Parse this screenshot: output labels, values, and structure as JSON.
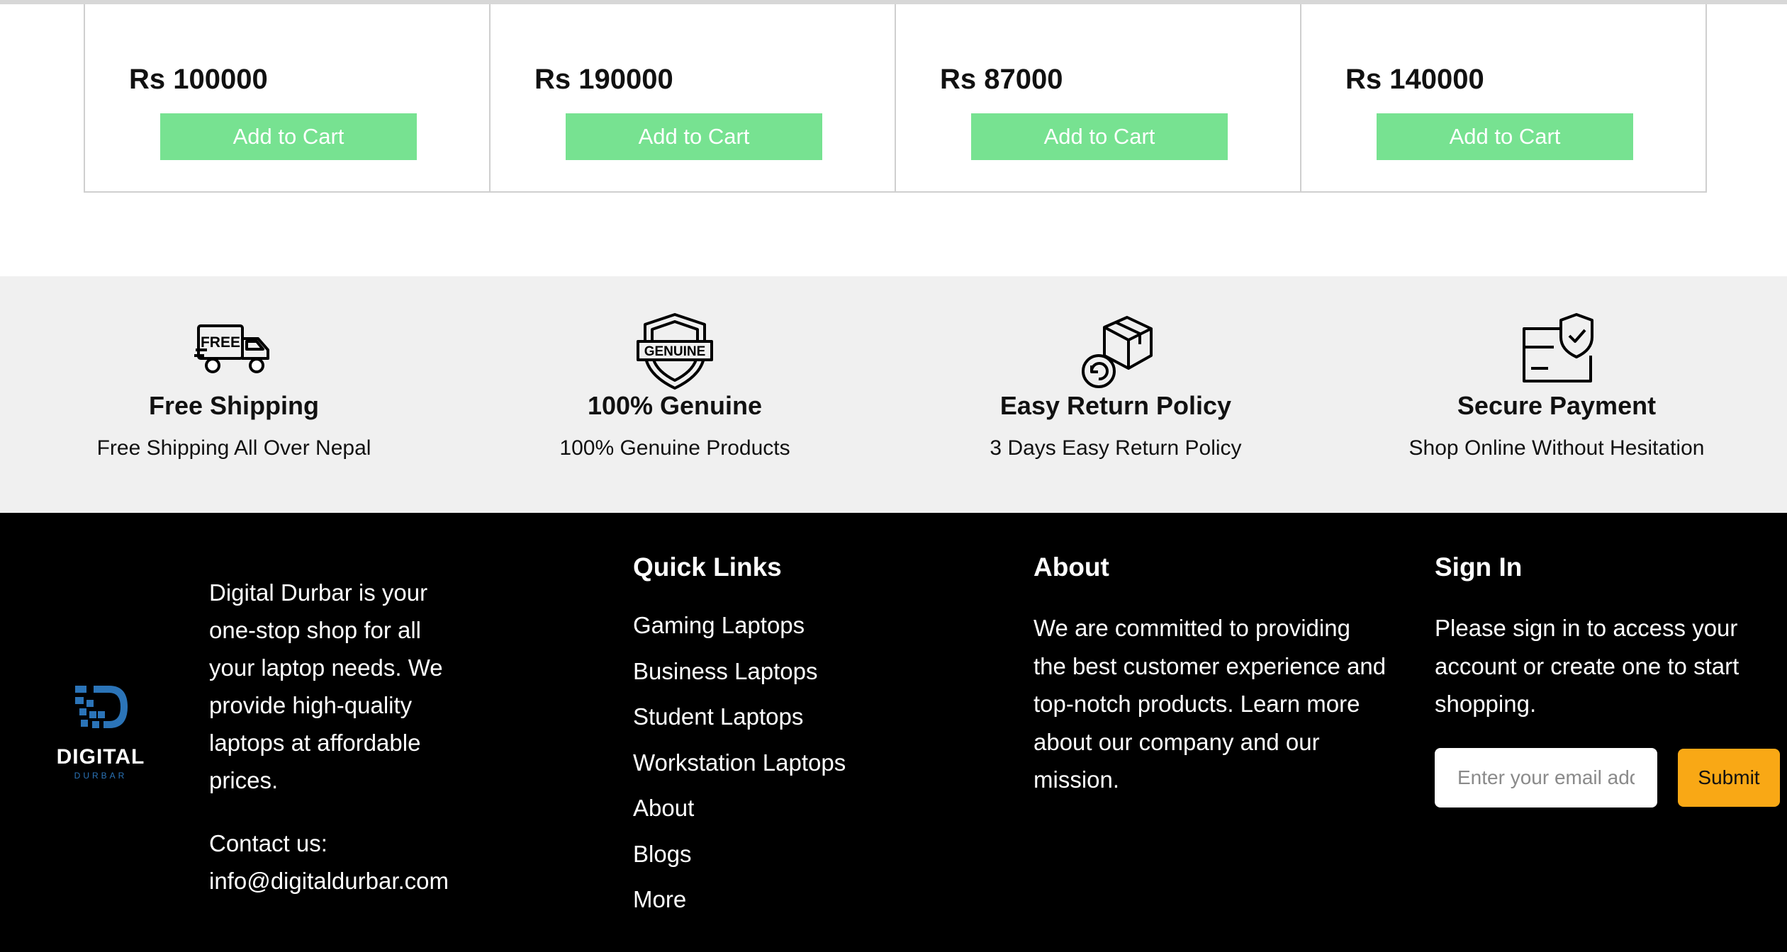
{
  "products": [
    {
      "price": "Rs 100000",
      "button": "Add to Cart"
    },
    {
      "price": "Rs 190000",
      "button": "Add to Cart"
    },
    {
      "price": "Rs 87000",
      "button": "Add to Cart"
    },
    {
      "price": "Rs 140000",
      "button": "Add to Cart"
    }
  ],
  "features": [
    {
      "icon": "free-shipping-truck-icon",
      "title": "Free Shipping",
      "subtitle": "Free Shipping All Over Nepal"
    },
    {
      "icon": "genuine-shield-icon",
      "title": "100% Genuine",
      "subtitle": "100% Genuine Products"
    },
    {
      "icon": "return-box-icon",
      "title": "Easy Return Policy",
      "subtitle": "3 Days Easy Return Policy"
    },
    {
      "icon": "secure-payment-card-icon",
      "title": "Secure Payment",
      "subtitle": "Shop Online Without Hesitation"
    }
  ],
  "footer": {
    "logo": {
      "name": "DIGITAL",
      "sub": "DURBAR",
      "icon": "digital-durbar-logo-icon"
    },
    "intro": "Digital Durbar is your one-stop shop for all your laptop needs. We provide high-quality laptops at affordable prices.",
    "contact_label": "Contact us:",
    "contact_email": "info@digitaldurbar.com",
    "quick_links": {
      "title": "Quick Links",
      "items": [
        "Gaming Laptops",
        "Business Laptops",
        "Student Laptops",
        "Workstation Laptops",
        "About",
        "Blogs",
        "More"
      ]
    },
    "about": {
      "title": "About",
      "text": "We are committed to providing the best customer experience and top-notch products. Learn more about our company and our mission."
    },
    "signin": {
      "title": "Sign In",
      "text": "Please sign in to access your account or create one to start shopping.",
      "email_placeholder": "Enter your email address",
      "submit_label": "Submit"
    }
  },
  "colors": {
    "cart_button": "#77e291",
    "features_bg": "#f0f0f0",
    "footer_bg": "#000000",
    "submit_button": "#f9a815",
    "logo_blue": "#2b74b8"
  }
}
